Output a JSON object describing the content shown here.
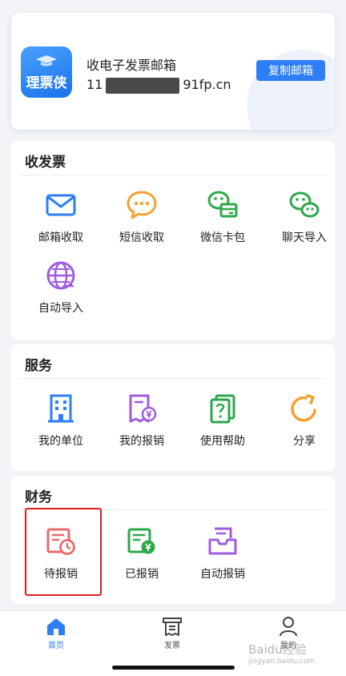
{
  "email_card": {
    "logo_text": "理票侠",
    "title": "收电子发票邮箱",
    "address_prefix": "11",
    "address_suffix": "91fp.cn",
    "copy_label": "复制邮箱"
  },
  "sections": {
    "receive": {
      "title": "收发票",
      "items": [
        {
          "label": "邮箱收取",
          "icon": "mail-icon"
        },
        {
          "label": "短信收取",
          "icon": "sms-icon"
        },
        {
          "label": "微信卡包",
          "icon": "wechat-card-icon"
        },
        {
          "label": "聊天导入",
          "icon": "wechat-chat-icon"
        },
        {
          "label": "自动导入",
          "icon": "auto-import-icon"
        }
      ]
    },
    "service": {
      "title": "服务",
      "items": [
        {
          "label": "我的单位",
          "icon": "building-icon"
        },
        {
          "label": "我的报销",
          "icon": "receipt-yen-icon"
        },
        {
          "label": "使用帮助",
          "icon": "help-icon"
        },
        {
          "label": "分享",
          "icon": "share-icon"
        }
      ]
    },
    "finance": {
      "title": "财务",
      "items": [
        {
          "label": "待报销",
          "icon": "pending-clock-icon"
        },
        {
          "label": "已报销",
          "icon": "reimbursed-yen-icon"
        },
        {
          "label": "自动报销",
          "icon": "tray-icon"
        }
      ]
    }
  },
  "tabbar": {
    "tabs": [
      {
        "label": "首页",
        "icon": "home-icon",
        "active": true
      },
      {
        "label": "发票",
        "icon": "invoice-icon",
        "active": false
      },
      {
        "label": "我的",
        "icon": "user-icon",
        "active": false
      }
    ]
  },
  "watermark": {
    "line1": "Baidu经验",
    "line2": "jingyan.baidu.com"
  },
  "colors": {
    "accent": "#2d7ef7",
    "highlight": "#e02020",
    "orange": "#f5a030",
    "green": "#2ba84a",
    "purple": "#a05ce0",
    "red": "#e86a6a"
  }
}
